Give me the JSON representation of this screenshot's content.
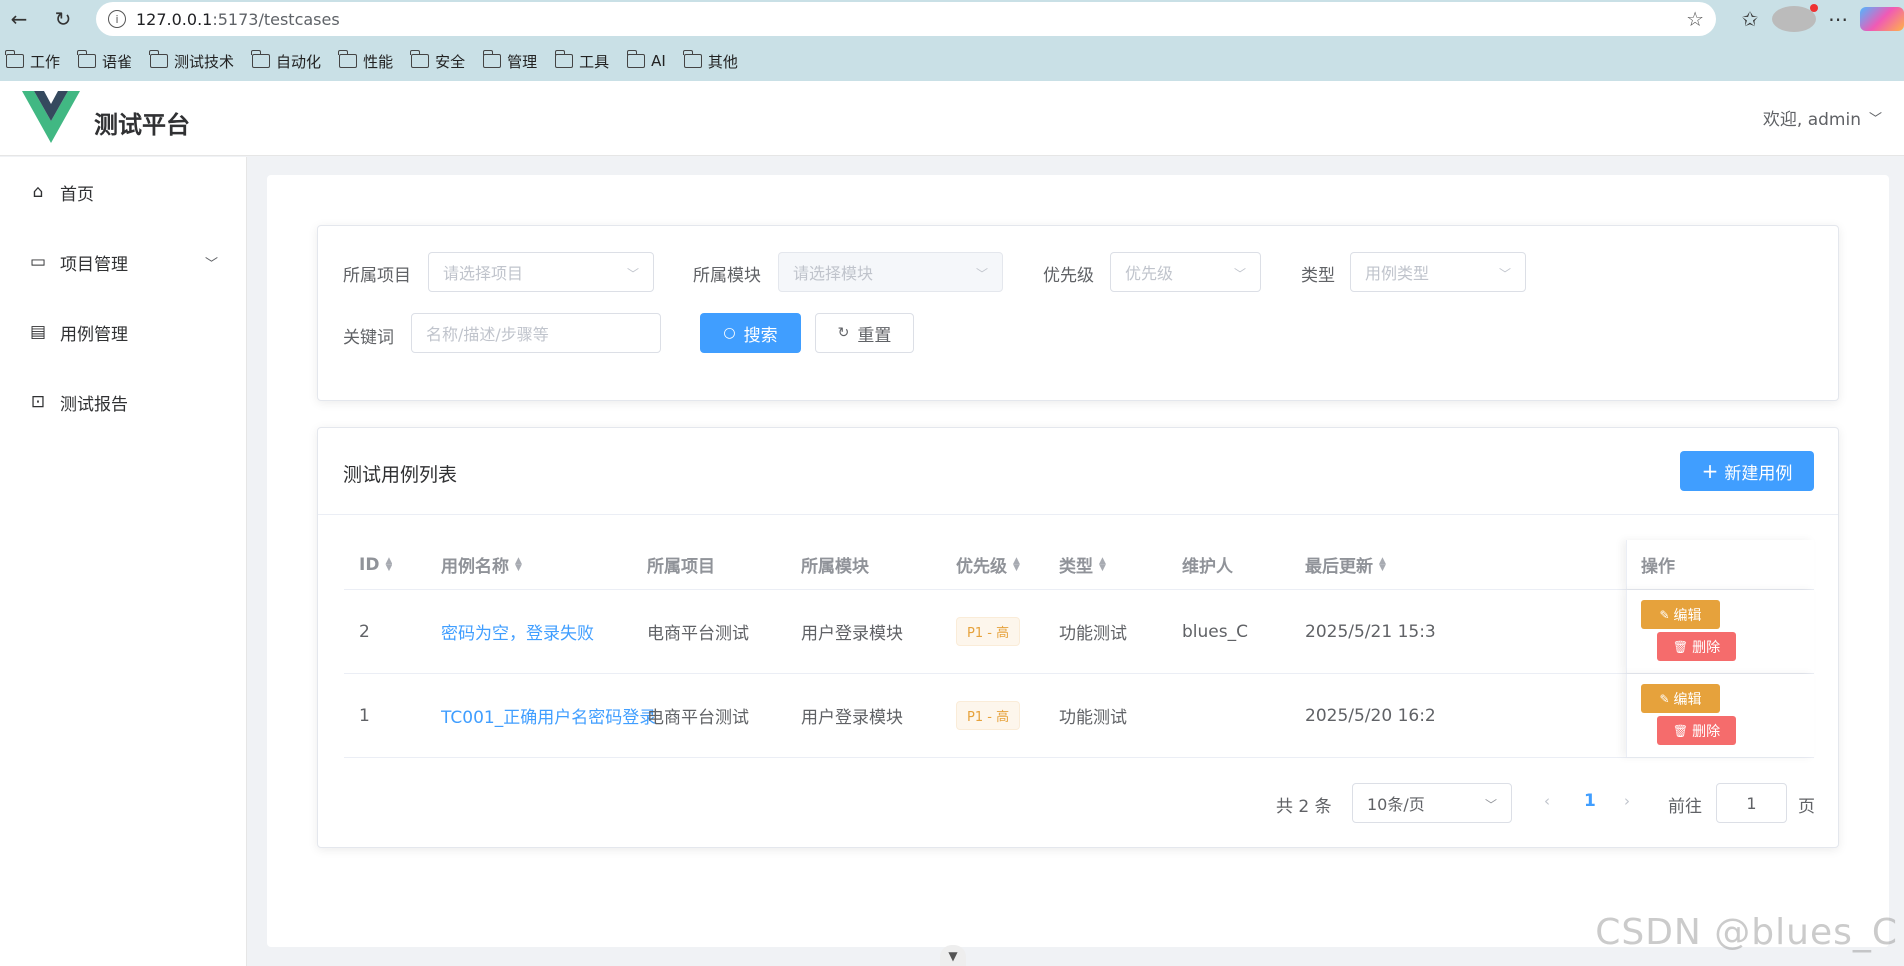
{
  "browser": {
    "url_host": "127.0.0.1",
    "url_path": ":5173/testcases",
    "bookmarks": [
      "工作",
      "语雀",
      "测试技术",
      "自动化",
      "性能",
      "安全",
      "管理",
      "工具",
      "AI",
      "其他"
    ]
  },
  "app": {
    "title": "测试平台",
    "welcome": "欢迎, admin"
  },
  "sidebar": {
    "items": [
      {
        "label": "首页"
      },
      {
        "label": "项目管理"
      },
      {
        "label": "用例管理"
      },
      {
        "label": "测试报告"
      }
    ]
  },
  "filter": {
    "project_label": "所属项目",
    "project_placeholder": "请选择项目",
    "module_label": "所属模块",
    "module_placeholder": "请选择模块",
    "priority_label": "优先级",
    "priority_placeholder": "优先级",
    "type_label": "类型",
    "type_placeholder": "用例类型",
    "keyword_label": "关键词",
    "keyword_placeholder": "名称/描述/步骤等",
    "search_label": "搜索",
    "reset_label": "重置"
  },
  "list": {
    "title": "测试用例列表",
    "new_label": "新建用例",
    "columns": [
      "ID",
      "用例名称",
      "所属项目",
      "所属模块",
      "优先级",
      "类型",
      "维护人",
      "最后更新",
      "操作"
    ],
    "rows": [
      {
        "id": "2",
        "name": "密码为空，登录失败",
        "project": "电商平台测试",
        "module": "用户登录模块",
        "priority": "P1 - 高",
        "type": "功能测试",
        "maintainer": "blues_C",
        "updated": "2025/5/21 15:3"
      },
      {
        "id": "1",
        "name": "TC001_正确用户名密码登录",
        "project": "电商平台测试",
        "module": "用户登录模块",
        "priority": "P1 - 高",
        "type": "功能测试",
        "maintainer": "",
        "updated": "2025/5/20 16:2"
      }
    ],
    "edit_label": "编辑",
    "delete_label": "删除"
  },
  "pagination": {
    "total": "共 2 条",
    "page_size": "10条/页",
    "current": "1",
    "goto_label": "前往",
    "goto_value": "1",
    "page_suffix": "页"
  },
  "watermark": "CSDN @blues_C"
}
